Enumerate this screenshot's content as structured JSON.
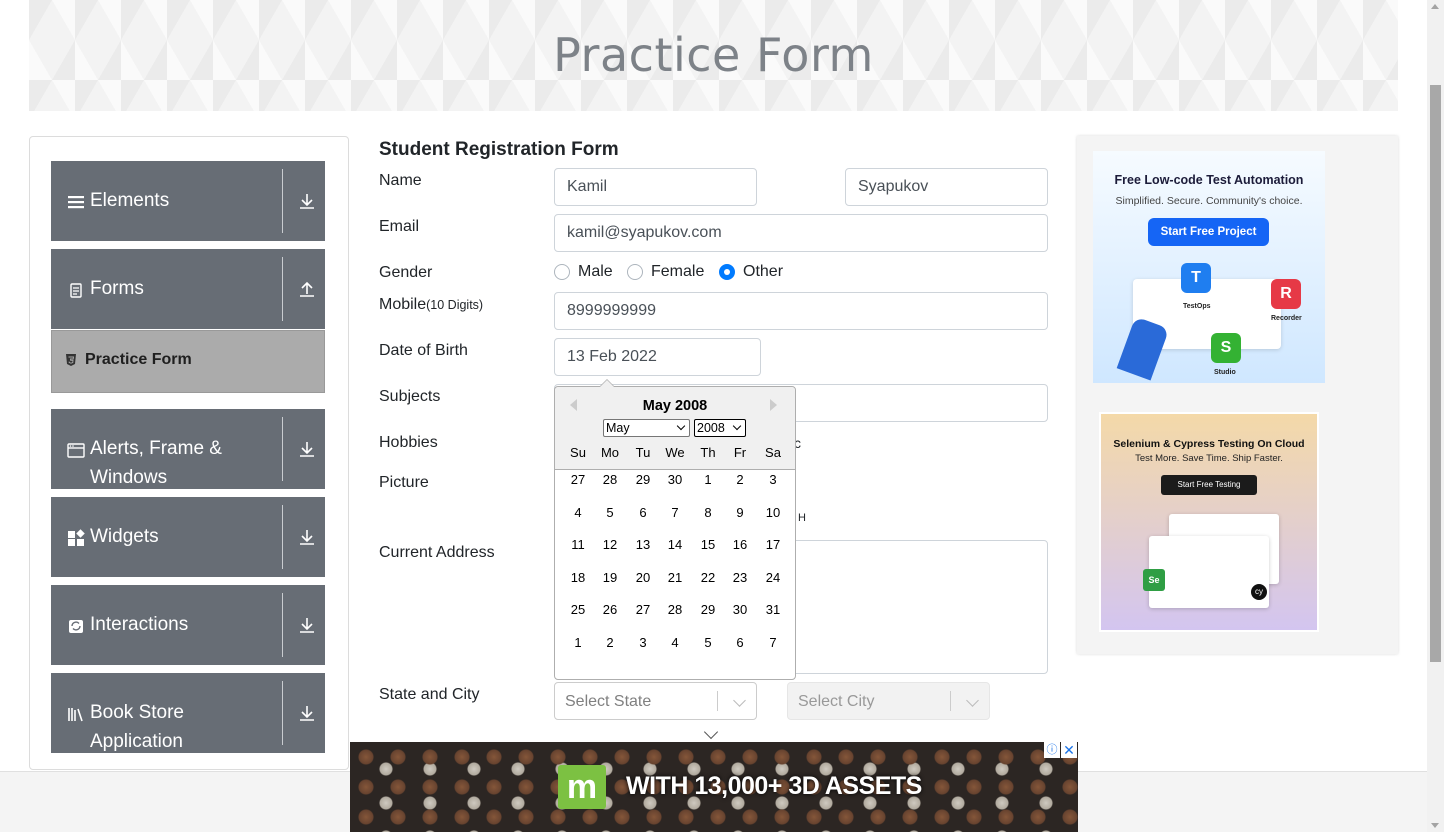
{
  "page_title": "Practice Form",
  "sidebar": {
    "groups": [
      {
        "label": "Elements",
        "icon": "menu-icon",
        "arrow": "download"
      },
      {
        "label": "Forms",
        "icon": "document-icon",
        "arrow": "upload"
      },
      {
        "label": "Alerts, Frame & Windows",
        "icon": "window-icon",
        "arrow": "download"
      },
      {
        "label": "Widgets",
        "icon": "widgets-icon",
        "arrow": "download"
      },
      {
        "label": "Interactions",
        "icon": "interactions-icon",
        "arrow": "download"
      },
      {
        "label": "Book Store Application",
        "icon": "books-icon",
        "arrow": "download"
      }
    ],
    "active_item": {
      "label": "Practice Form",
      "icon": "html5-icon"
    }
  },
  "form": {
    "heading": "Student Registration Form",
    "name_label": "Name",
    "first_name": "Kamil",
    "last_name": "Syapukov",
    "email_label": "Email",
    "email": "kamil@syapukov.com",
    "gender_label": "Gender",
    "gender_options": [
      "Male",
      "Female",
      "Other"
    ],
    "gender_selected": "Other",
    "mobile_label": "Mobile",
    "mobile_hint": "(10 Digits)",
    "mobile": "8999999999",
    "dob_label": "Date of Birth",
    "dob": "13 Feb 2022",
    "subjects_label": "Subjects",
    "hobbies_label": "Hobbies",
    "hobbies_partial": "c",
    "picture_label": "Picture",
    "picture_partial": "H",
    "address_label": "Current Address",
    "state_city_label": "State and City",
    "state_placeholder": "Select State",
    "city_placeholder": "Select City"
  },
  "datepicker": {
    "title": "May 2008",
    "month_select": "May",
    "year_select": "2008",
    "weekdays": [
      "Su",
      "Mo",
      "Tu",
      "We",
      "Th",
      "Fr",
      "Sa"
    ],
    "weeks": [
      [
        "27",
        "28",
        "29",
        "30",
        "1",
        "2",
        "3"
      ],
      [
        "4",
        "5",
        "6",
        "7",
        "8",
        "9",
        "10"
      ],
      [
        "11",
        "12",
        "13",
        "14",
        "15",
        "16",
        "17"
      ],
      [
        "18",
        "19",
        "20",
        "21",
        "22",
        "23",
        "24"
      ],
      [
        "25",
        "26",
        "27",
        "28",
        "29",
        "30",
        "31"
      ],
      [
        "1",
        "2",
        "3",
        "4",
        "5",
        "6",
        "7"
      ]
    ]
  },
  "ads": {
    "ad1": {
      "title": "Free Low-code Test Automation",
      "subtitle": "Simplified. Secure. Community's choice.",
      "button": "Start Free Project",
      "products": [
        "TestOps",
        "Recorder",
        "Studio"
      ]
    },
    "ad2": {
      "title": "Selenium & Cypress Testing On Cloud",
      "subtitle": "Test More. Save Time. Ship Faster.",
      "button": "Start Free Testing"
    },
    "bottom": {
      "text": "WITH 13,000+ 3D ASSETS",
      "logo": "m",
      "close": "✕",
      "info": "ⓘ"
    }
  },
  "colors": {
    "sidebar_group": "#676d75",
    "sidebar_active": "#ababab",
    "radio_checked": "#007bff",
    "ad_button": "#1565f5"
  }
}
